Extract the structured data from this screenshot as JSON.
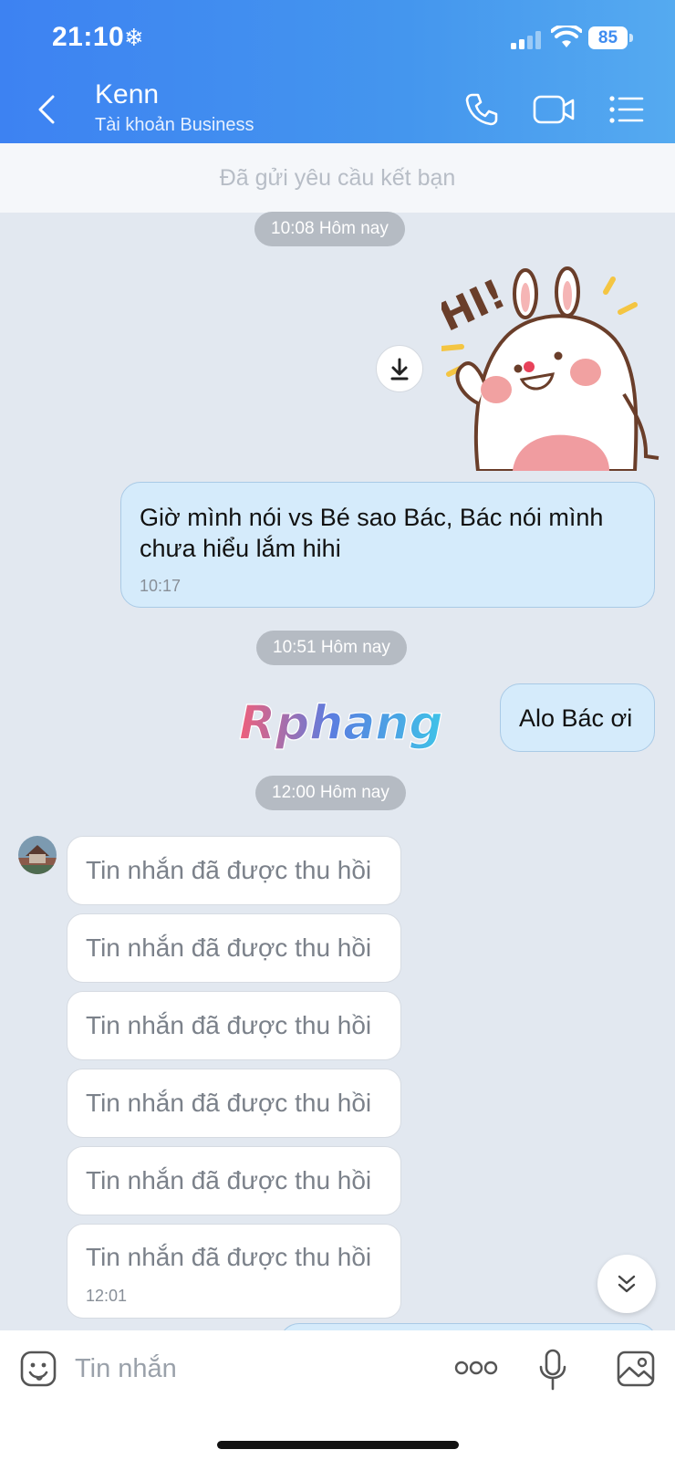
{
  "status_bar": {
    "time": "21:10",
    "battery": "85"
  },
  "header": {
    "title": "Kenn",
    "subtitle": "Tài khoản Business"
  },
  "friend_request": "Đã gửi yêu cầu kết bạn",
  "messages": {
    "sep1": "10:08 Hôm nay",
    "out1_text": "Giờ mình nói vs Bé sao Bác, Bác nói mình chưa hiểu lắm hihi",
    "out1_time": "10:17",
    "sep2": "10:51 Hôm nay",
    "out2_text": "Alo Bác ơi",
    "sep3": "12:00 Hôm nay",
    "recalled": [
      "Tin nhắn đã được thu hồi",
      "Tin nhắn đã được thu hồi",
      "Tin nhắn đã được thu hồi",
      "Tin nhắn đã được thu hồi",
      "Tin nhắn đã được thu hồi",
      "Tin nhắn đã được thu hồi"
    ],
    "recalled_last_time": "12:01",
    "sticker_text": "HI!"
  },
  "watermark": "Rphang",
  "composer": {
    "placeholder": "Tin nhắn"
  },
  "icons": [
    "chevron-left-icon",
    "phone-icon",
    "video-icon",
    "menu-icon",
    "download-icon",
    "chevron-down-icon",
    "emoji-icon",
    "more-icon",
    "mic-icon",
    "image-icon"
  ],
  "colors": {
    "header": "#3d82f2",
    "bubble_out": "#d5ebfb",
    "background": "#e2e8f0"
  }
}
